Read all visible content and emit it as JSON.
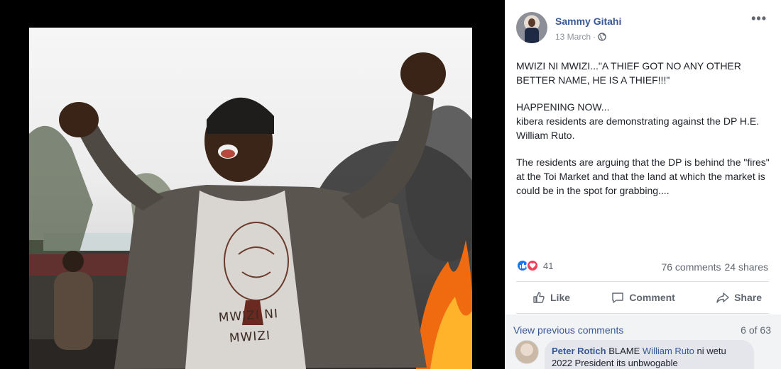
{
  "post": {
    "author": "Sammy Gitahi",
    "date": "13 March",
    "date_sep": "·",
    "privacy_icon": "globe-icon",
    "more_icon": "more-options-icon",
    "more_text": "•••",
    "paragraphs": [
      "MWIZI NI MWIZI...\"A THIEF GOT NO ANY OTHER BETTER NAME, HE IS A THIEF!!!\"",
      "HAPPENING NOW...\nkibera residents are demonstrating against the DP H.E. William Ruto.",
      "The residents are arguing that the DP is behind the \"fires\" at the Toi Market and that the land at which the market is could be in the spot for grabbing...."
    ]
  },
  "photo": {
    "shirt_text_line1": "MWIZI NI",
    "shirt_text_line2": "MWIZI"
  },
  "stats": {
    "reaction_count": "41",
    "comments": "76 comments",
    "shares": "24 shares"
  },
  "actions": {
    "like": "Like",
    "comment": "Comment",
    "share": "Share"
  },
  "comments": {
    "view_previous": "View previous comments",
    "page_count": "6 of 63",
    "first": {
      "name": "Peter Rotich",
      "text_before": "BLAME",
      "link": "William Ruto",
      "text_after": "ni wetu",
      "line2": "2022 President its unbwogable"
    }
  },
  "colors": {
    "link": "#385898",
    "like_blue": "#1877f2",
    "love_red": "#f33e58",
    "muted": "#606770"
  }
}
